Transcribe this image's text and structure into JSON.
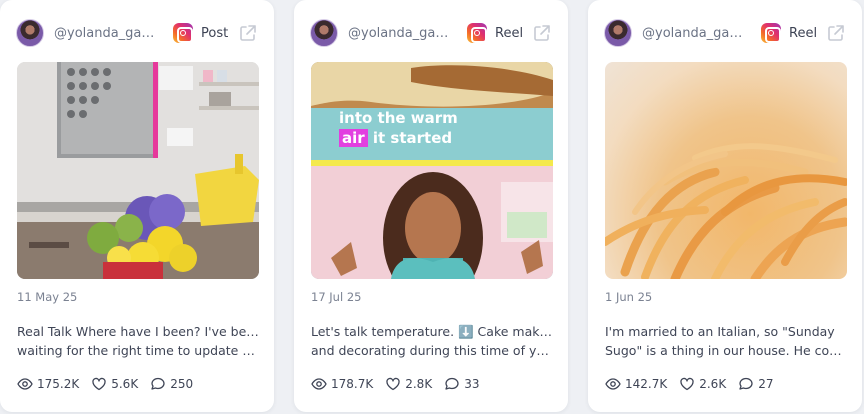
{
  "cards": [
    {
      "handle": "@yolanda_gam...",
      "platform_icon": "instagram-icon",
      "post_type": "Post",
      "date": "11 May 25",
      "caption_line1": "Real Talk Where have I been? I've been",
      "caption_line2": "waiting for the right time to update you...",
      "views": "175.2K",
      "likes": "5.6K",
      "comments": "250"
    },
    {
      "handle": "@yolanda_gam...",
      "platform_icon": "instagram-icon",
      "post_type": "Reel",
      "overlay_line1": "into the warm",
      "overlay_highlight": "air",
      "overlay_line2_rest": " it started",
      "date": "17 Jul 25",
      "caption_line1": "Let's talk temperature. ⬇️ Cake making",
      "caption_line2": "and decorating during this time of year,...",
      "views": "178.7K",
      "likes": "2.8K",
      "comments": "33"
    },
    {
      "handle": "@yolanda_gam...",
      "platform_icon": "instagram-icon",
      "post_type": "Reel",
      "date": "1 Jun 25",
      "caption_line1": "I'm married to an Italian, so \"Sunday",
      "caption_line2": "Sugo\" is a thing in our house. He cooks...",
      "views": "142.7K",
      "likes": "2.6K",
      "comments": "27"
    }
  ],
  "colors": {
    "background": "#eef0f4",
    "card": "#ffffff",
    "text": "#3f4556",
    "muted": "#7b8292",
    "reel_highlight": "#e23fe0"
  }
}
